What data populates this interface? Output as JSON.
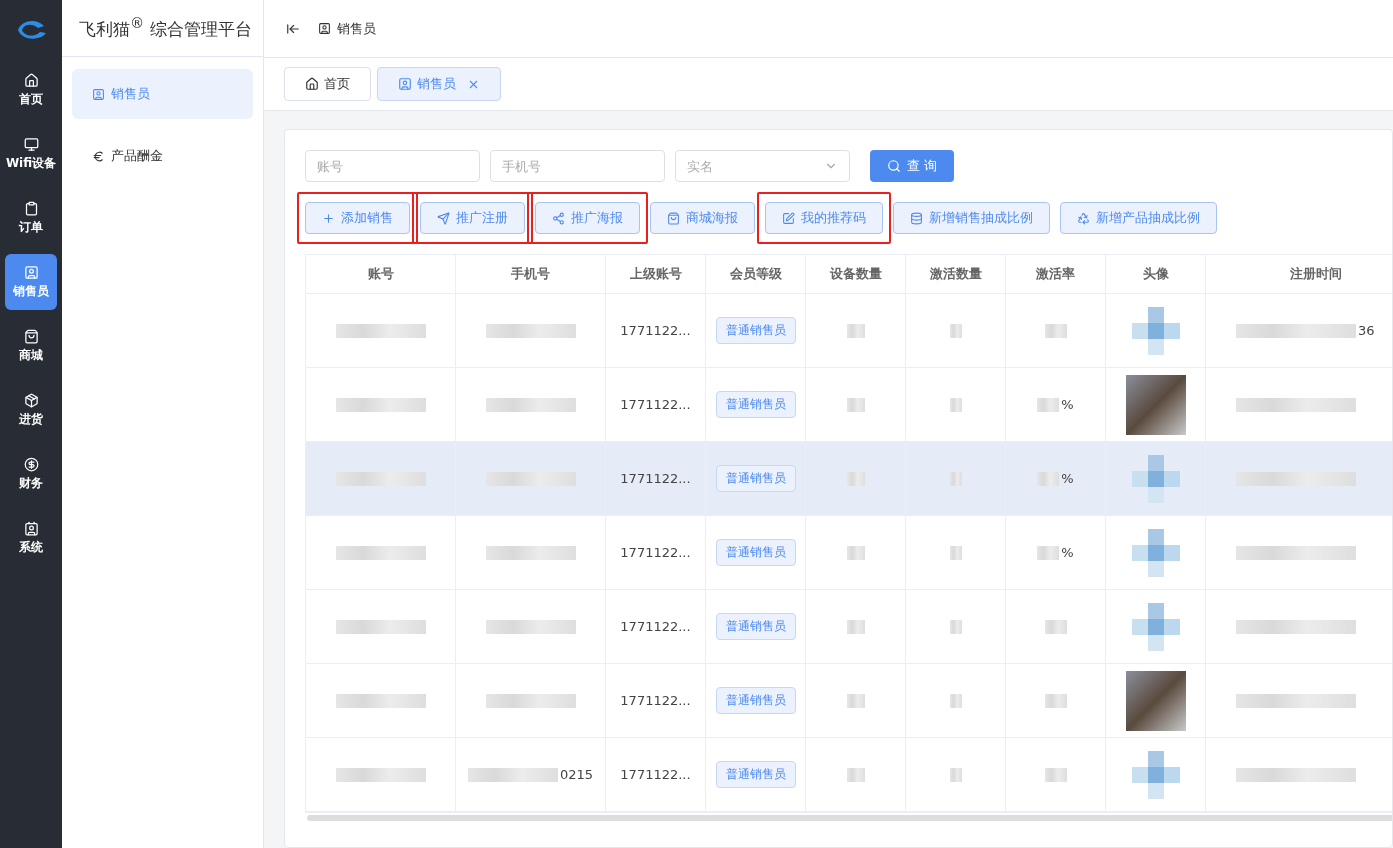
{
  "brand": {
    "name": "飞利猫",
    "mark": "®",
    "subtitle": "综合管理平台"
  },
  "rail": [
    {
      "label": "首页",
      "selected": false
    },
    {
      "label": "Wifi设备",
      "selected": false
    },
    {
      "label": "订单",
      "selected": false
    },
    {
      "label": "销售员",
      "selected": true
    },
    {
      "label": "商城",
      "selected": false
    },
    {
      "label": "进货",
      "selected": false
    },
    {
      "label": "财务",
      "selected": false
    },
    {
      "label": "系统",
      "selected": false
    }
  ],
  "submenu": [
    {
      "label": "销售员",
      "selected": true
    },
    {
      "label": "产品酬金",
      "selected": false
    }
  ],
  "breadcrumb": "销售员",
  "tabs": [
    {
      "label": "首页",
      "selected": false,
      "closable": false
    },
    {
      "label": "销售员",
      "selected": true,
      "closable": true
    }
  ],
  "filters": [
    {
      "kind": "text",
      "placeholder": "账号"
    },
    {
      "kind": "text",
      "placeholder": "手机号"
    },
    {
      "kind": "select",
      "placeholder": "实名"
    }
  ],
  "search_button": "查 询",
  "actions": [
    {
      "label": "添加销售",
      "highlighted": true
    },
    {
      "label": "推广注册",
      "highlighted": true
    },
    {
      "label": "推广海报",
      "highlighted": true
    },
    {
      "label": "商城海报",
      "highlighted": false
    },
    {
      "label": "我的推荐码",
      "highlighted": true
    },
    {
      "label": "新增销售抽成比例",
      "highlighted": false
    },
    {
      "label": "新增产品抽成比例",
      "highlighted": false
    }
  ],
  "table": {
    "columns": [
      "账号",
      "手机号",
      "上级账号",
      "会员等级",
      "设备数量",
      "激活数量",
      "激活率",
      "头像",
      "注册时间"
    ],
    "rows": [
      {
        "hovered": false,
        "phone": "",
        "parent": "1771122...",
        "level": "普通销售员",
        "rate": "",
        "avatar": {
          "kind": "pixel"
        },
        "time": "36"
      },
      {
        "hovered": false,
        "phone": "",
        "parent": "1771122...",
        "level": "普通销售员",
        "rate": "%",
        "avatar": {
          "kind": "photo"
        },
        "time": ""
      },
      {
        "hovered": true,
        "phone": "",
        "parent": "1771122...",
        "level": "普通销售员",
        "rate": "%",
        "avatar": {
          "kind": "pixel"
        },
        "time": ""
      },
      {
        "hovered": false,
        "phone": "",
        "parent": "1771122...",
        "level": "普通销售员",
        "rate": "%",
        "avatar": {
          "kind": "pixel"
        },
        "time": ""
      },
      {
        "hovered": false,
        "phone": "",
        "parent": "1771122...",
        "level": "普通销售员",
        "rate": "",
        "avatar": {
          "kind": "pixel"
        },
        "time": ""
      },
      {
        "hovered": false,
        "phone": "",
        "parent": "1771122...",
        "level": "普通销售员",
        "rate": "",
        "avatar": {
          "kind": "photo"
        },
        "time": ""
      },
      {
        "hovered": false,
        "phone": "0215",
        "parent": "1771122...",
        "level": "普通销售员",
        "rate": "",
        "avatar": {
          "kind": "pixel"
        },
        "time": ""
      }
    ]
  }
}
